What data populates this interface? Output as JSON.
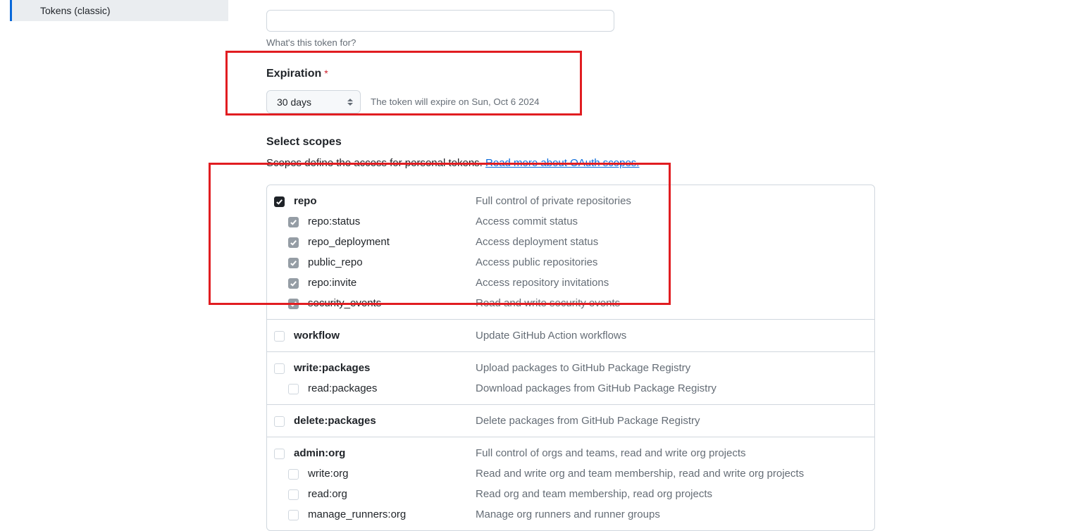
{
  "sidebar": {
    "active_item": "Tokens (classic)"
  },
  "note": {
    "hint": "What's this token for?"
  },
  "expiration": {
    "label": "Expiration",
    "value": "30 days",
    "note": "The token will expire on Sun, Oct 6 2024"
  },
  "scopes": {
    "label": "Select scopes",
    "desc_prefix": "Scopes define the access for personal tokens. ",
    "desc_link": "Read more about OAuth scopes."
  },
  "scope_groups": [
    {
      "name": "repo",
      "desc": "Full control of private repositories",
      "checked": true,
      "children": [
        {
          "name": "repo:status",
          "desc": "Access commit status"
        },
        {
          "name": "repo_deployment",
          "desc": "Access deployment status"
        },
        {
          "name": "public_repo",
          "desc": "Access public repositories"
        },
        {
          "name": "repo:invite",
          "desc": "Access repository invitations"
        },
        {
          "name": "security_events",
          "desc": "Read and write security events"
        }
      ]
    },
    {
      "name": "workflow",
      "desc": "Update GitHub Action workflows",
      "checked": false,
      "children": []
    },
    {
      "name": "write:packages",
      "desc": "Upload packages to GitHub Package Registry",
      "checked": false,
      "children": [
        {
          "name": "read:packages",
          "desc": "Download packages from GitHub Package Registry"
        }
      ]
    },
    {
      "name": "delete:packages",
      "desc": "Delete packages from GitHub Package Registry",
      "checked": false,
      "children": []
    },
    {
      "name": "admin:org",
      "desc": "Full control of orgs and teams, read and write org projects",
      "checked": false,
      "children": [
        {
          "name": "write:org",
          "desc": "Read and write org and team membership, read and write org projects"
        },
        {
          "name": "read:org",
          "desc": "Read org and team membership, read org projects"
        },
        {
          "name": "manage_runners:org",
          "desc": "Manage org runners and runner groups"
        }
      ]
    }
  ]
}
